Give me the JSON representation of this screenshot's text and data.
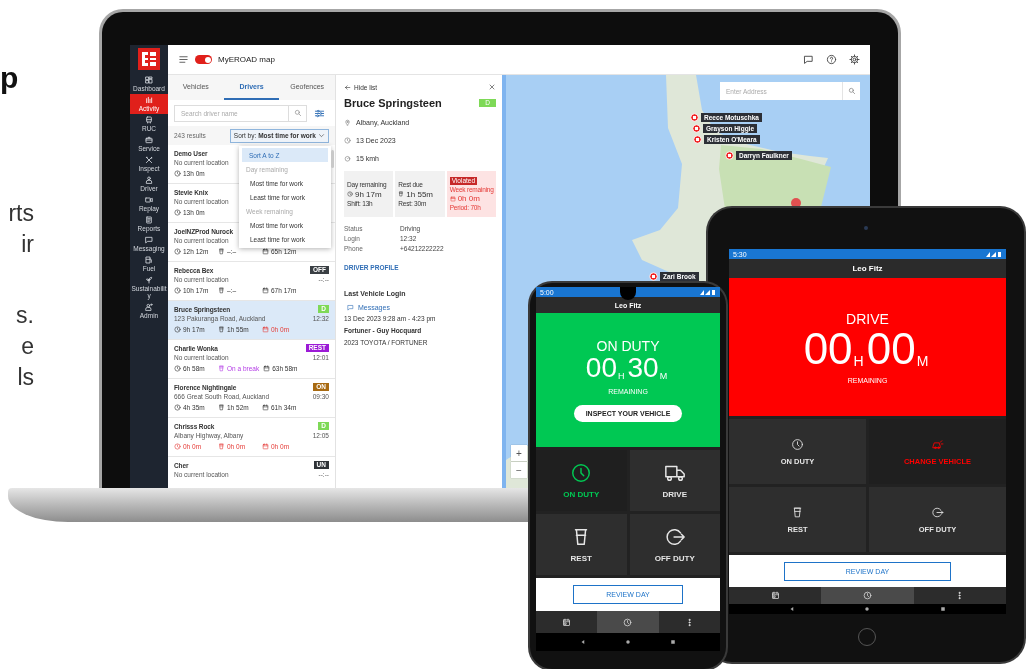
{
  "copy_fragments": {
    "heading": "p",
    "lines": [
      "rts",
      "ir",
      "s.",
      "e",
      "ls"
    ]
  },
  "web_app": {
    "top_bar": {
      "map_toggle": {
        "on": true,
        "label": "MyEROAD map"
      }
    },
    "nav": [
      {
        "kind": "dashboard",
        "label": "Dashboard",
        "selected": false
      },
      {
        "kind": "activity",
        "label": "Activity",
        "selected": true
      },
      {
        "kind": "ruc",
        "label": "RUC",
        "selected": false
      },
      {
        "kind": "service",
        "label": "Service",
        "selected": false
      },
      {
        "kind": "inspect",
        "label": "Inspect",
        "selected": false
      },
      {
        "kind": "driver",
        "label": "Driver",
        "selected": false
      },
      {
        "kind": "replay",
        "label": "Replay",
        "selected": false
      },
      {
        "kind": "reports",
        "label": "Reports",
        "selected": false
      },
      {
        "kind": "messaging",
        "label": "Messaging",
        "selected": false
      },
      {
        "kind": "fuel",
        "label": "Fuel",
        "selected": false
      },
      {
        "kind": "sustainability",
        "label": "Sustainability",
        "selected": false
      },
      {
        "kind": "admin",
        "label": "Admin",
        "selected": false
      }
    ],
    "tabs": [
      {
        "label": "Vehicles",
        "selected": false
      },
      {
        "label": "Drivers",
        "selected": true
      },
      {
        "label": "Geofences",
        "selected": false
      }
    ],
    "search": {
      "placeholder": "Search driver name"
    },
    "result_count": "243 results",
    "sort": {
      "label": "Sort by: **Most time for work**"
    },
    "sort_menu": [
      {
        "kind": "option",
        "label": "Sort A to Z",
        "selected": true
      },
      {
        "kind": "header",
        "label": "Day remaining"
      },
      {
        "kind": "option",
        "label": "Most time for work",
        "selected": false
      },
      {
        "kind": "option",
        "label": "Least time for work",
        "selected": false
      },
      {
        "kind": "header",
        "label": "Week remaining"
      },
      {
        "kind": "option",
        "label": "Most time for work",
        "selected": false
      },
      {
        "kind": "option",
        "label": "Least time for work",
        "selected": false
      }
    ],
    "drivers": [
      {
        "name": "Demo User",
        "location": "No current location",
        "selected": false,
        "stats": [
          {
            "kind": "clock",
            "text": "13h 0m",
            "alert": false
          }
        ]
      },
      {
        "name": "Stevie Knix",
        "location": "No current location",
        "selected": false,
        "stats": [
          {
            "kind": "clock",
            "text": "13h 0m",
            "alert": false
          }
        ]
      },
      {
        "name": "JoelNZProd Nurock",
        "location": "No current location",
        "selected": false,
        "stats": [
          {
            "kind": "clock",
            "text": "12h 12m",
            "alert": false
          },
          {
            "kind": "rest",
            "text": "–:–",
            "alert": false
          },
          {
            "kind": "week",
            "text": "65h 12m",
            "alert": false
          }
        ]
      },
      {
        "name": "Rebecca Bex",
        "location": "No current location",
        "selected": false,
        "badge": {
          "text": "OFF",
          "color": "#3a3f44"
        },
        "time": "--:--",
        "stats": [
          {
            "kind": "clock",
            "text": "10h 17m",
            "alert": false
          },
          {
            "kind": "rest",
            "text": "–:–",
            "alert": false
          },
          {
            "kind": "week",
            "text": "67h 17m",
            "alert": false
          }
        ]
      },
      {
        "name": "Bruce Springsteen",
        "location": "123 Pakuranga Road, Auckland",
        "selected": true,
        "badge": {
          "text": "D",
          "color": "#7ed957"
        },
        "time": "12:32",
        "stats": [
          {
            "kind": "clock",
            "text": "9h 17m",
            "alert": false
          },
          {
            "kind": "rest",
            "text": "1h 55m",
            "alert": false
          },
          {
            "kind": "week",
            "text": "0h 0m",
            "alert": true
          }
        ]
      },
      {
        "name": "Charlie Wonka",
        "location": "No current location",
        "selected": false,
        "badge": {
          "text": "REST",
          "color": "#9c1bd6"
        },
        "time": "12:01",
        "stats": [
          {
            "kind": "clock",
            "text": "6h 58m",
            "alert": false
          },
          {
            "kind": "break",
            "text": "On a break",
            "alert": false
          },
          {
            "kind": "week",
            "text": "63h 58m",
            "alert": false
          }
        ]
      },
      {
        "name": "Florence Nightingale",
        "location": "666 Great South Road, Auckland",
        "selected": false,
        "badge": {
          "text": "ON",
          "color": "#a86a12"
        },
        "time": "09:30",
        "stats": [
          {
            "kind": "clock",
            "text": "4h 35m",
            "alert": false
          },
          {
            "kind": "rest",
            "text": "1h 52m",
            "alert": false
          },
          {
            "kind": "week",
            "text": "61h 34m",
            "alert": false
          }
        ]
      },
      {
        "name": "Chrisss Rock",
        "location": "Albany Highway, Albany",
        "selected": false,
        "badge": {
          "text": "D",
          "color": "#7ed957"
        },
        "time": "12:05",
        "stats": [
          {
            "kind": "clock",
            "text": "0h 0m",
            "alert": true
          },
          {
            "kind": "rest",
            "text": "0h 0m",
            "alert": true
          },
          {
            "kind": "week",
            "text": "0h 0m",
            "alert": true
          }
        ]
      },
      {
        "name": "Cher",
        "location": "No current location",
        "selected": false,
        "badge": {
          "text": "UN",
          "color": "#2f3338"
        },
        "time": "--:--"
      }
    ],
    "detail": {
      "hide_label": "Hide list",
      "name": "Bruce Springsteen",
      "badge": {
        "text": "D",
        "color": "#7ed957"
      },
      "info": [
        {
          "kind": "pin",
          "text": "Albany, Auckland"
        },
        {
          "kind": "clock",
          "text": "13 Dec 2023"
        },
        {
          "kind": "gauge",
          "text": "15 kmh"
        }
      ],
      "cards": [
        {
          "kind": "clock",
          "label": "Day remaining",
          "value": "9h 17m",
          "sub": "Shift: 13h",
          "violated": false
        },
        {
          "kind": "rest",
          "label": "Rest due",
          "value": "1h 55m",
          "sub": "Rest: 30m",
          "violated": false
        },
        {
          "kind": "week",
          "tag": "Violated",
          "label": "Week remaining",
          "value": "0h 0m",
          "sub": "Period: 70h",
          "violated": true
        }
      ],
      "fields": [
        {
          "label": "Status",
          "value": "Driving"
        },
        {
          "label": "Login",
          "value": "12:32"
        },
        {
          "label": "Phone",
          "value": "+64212222222"
        }
      ],
      "profile_link": "DRIVER PROFILE",
      "last_login": {
        "heading": "Last Vehicle Login",
        "link": "Messages",
        "lines": [
          "13 Dec 2023 9:28 am - 4:23 pm",
          "Fortuner - Guy Hocquard",
          "2023 TOYOTA / FORTUNER"
        ]
      }
    },
    "map": {
      "search_placeholder": "Enter Address",
      "pins": [
        {
          "label": "Reece Motuschka"
        },
        {
          "label": "Grayson Higgie"
        },
        {
          "label": "Kristen O'Meara"
        },
        {
          "label": "Darryn Faulkner"
        },
        {
          "label": "Zari Brook"
        }
      ],
      "zoom": [
        "+",
        "−"
      ]
    }
  },
  "mobile_apps": [
    {
      "kind": "phone",
      "status_time": "5:00",
      "driver": "Leo Fitz",
      "color": "#00c853",
      "state": "ON DUTY",
      "hours": "00",
      "hours_unit": "H",
      "minutes": "30",
      "minutes_unit": "M",
      "caption": "REMAINING",
      "action": "INSPECT YOUR VEHICLE",
      "buttons": [
        {
          "kind": "clock",
          "label": "ON DUTY",
          "active": true
        },
        {
          "kind": "truck",
          "label": "DRIVE",
          "active": false
        },
        {
          "kind": "cup",
          "label": "REST",
          "active": false
        },
        {
          "kind": "exit",
          "label": "OFF DUTY",
          "active": false
        }
      ],
      "review": "REVIEW DAY",
      "tabs": [
        {
          "kind": "calendar",
          "selected": false
        },
        {
          "kind": "clock",
          "selected": true
        },
        {
          "kind": "more",
          "selected": false
        }
      ]
    },
    {
      "kind": "tablet",
      "status_time": "5:30",
      "driver": "Leo Fitz",
      "color": "#ff0000",
      "state": "DRIVE",
      "hours": "00",
      "hours_unit": "H",
      "minutes": "00",
      "minutes_unit": "M",
      "caption": "REMAINING",
      "buttons": [
        {
          "kind": "clock",
          "label": "ON DUTY",
          "active": false
        },
        {
          "kind": "car",
          "label": "CHANGE VEHICLE",
          "active": true
        },
        {
          "kind": "cup",
          "label": "REST",
          "active": false
        },
        {
          "kind": "exit",
          "label": "OFF DUTY",
          "active": false
        }
      ],
      "review": "REVIEW DAY",
      "tabs": [
        {
          "kind": "calendar",
          "selected": false
        },
        {
          "kind": "clock",
          "selected": true
        },
        {
          "kind": "more",
          "selected": false
        }
      ]
    }
  ]
}
